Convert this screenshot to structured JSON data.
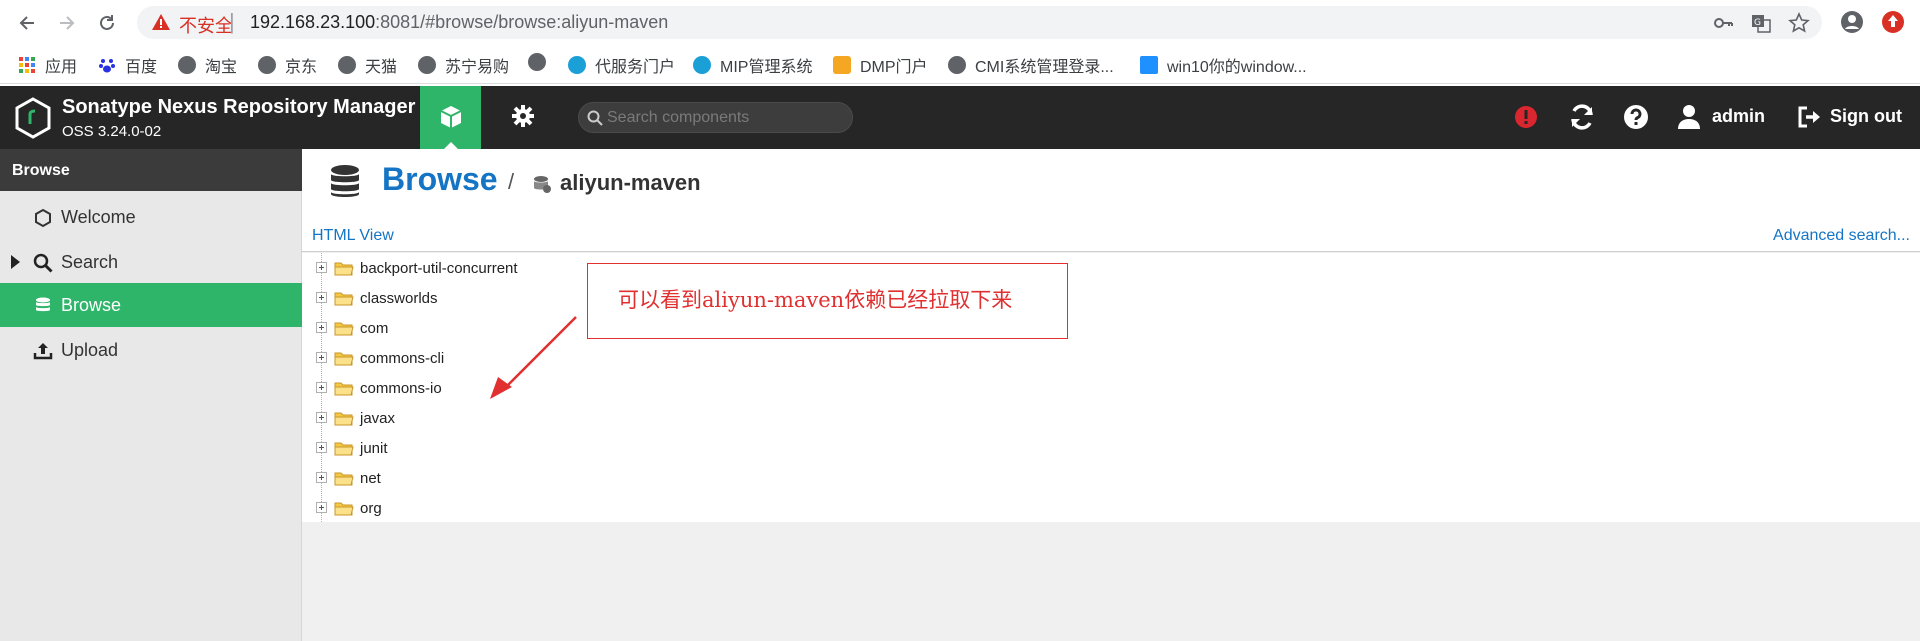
{
  "browser": {
    "insecure_label": "不安全",
    "url_host": "192.168.23.100",
    "url_rest": ":8081/#browse/browse:aliyun-maven"
  },
  "bookmarks": [
    {
      "label": "应用",
      "icon": "apps-grid-icon"
    },
    {
      "label": "百度",
      "icon": "baidu-paw-icon"
    },
    {
      "label": "淘宝",
      "icon": "globe-icon"
    },
    {
      "label": "京东",
      "icon": "globe-icon"
    },
    {
      "label": "天猫",
      "icon": "globe-icon"
    },
    {
      "label": "苏宁易购",
      "icon": "globe-icon"
    },
    {
      "label": "",
      "icon": "globe-icon"
    },
    {
      "label": "代服务门户",
      "icon": "china-mobile-icon"
    },
    {
      "label": "MIP管理系统",
      "icon": "china-mobile-icon"
    },
    {
      "label": "DMP门户",
      "icon": "dmp-icon"
    },
    {
      "label": "CMI系统管理登录...",
      "icon": "globe-icon"
    },
    {
      "label": "win10你的window...",
      "icon": "win10-icon"
    }
  ],
  "header": {
    "title": "Sonatype Nexus Repository Manager",
    "version": "OSS 3.24.0-02",
    "search_placeholder": "Search components",
    "user": "admin",
    "sign_out": "Sign out"
  },
  "sidebar": {
    "title": "Browse",
    "items": [
      {
        "label": "Welcome",
        "active": false
      },
      {
        "label": "Search",
        "active": false
      },
      {
        "label": "Browse",
        "active": true
      },
      {
        "label": "Upload",
        "active": false
      }
    ]
  },
  "main": {
    "crumb_root": "Browse",
    "crumb_sep": "/",
    "crumb_repo": "aliyun-maven",
    "html_view": "HTML View",
    "advanced_search": "Advanced search...",
    "tree": [
      "backport-util-concurrent",
      "classworlds",
      "com",
      "commons-cli",
      "commons-io",
      "javax",
      "junit",
      "net",
      "org"
    ]
  },
  "annotation": {
    "text": "可以看到aliyun-maven依赖已经拉取下来",
    "color": "#e03030"
  },
  "colors": {
    "accent_green": "#2fb56a",
    "link_blue": "#1575c4",
    "header_dark": "#262626"
  }
}
